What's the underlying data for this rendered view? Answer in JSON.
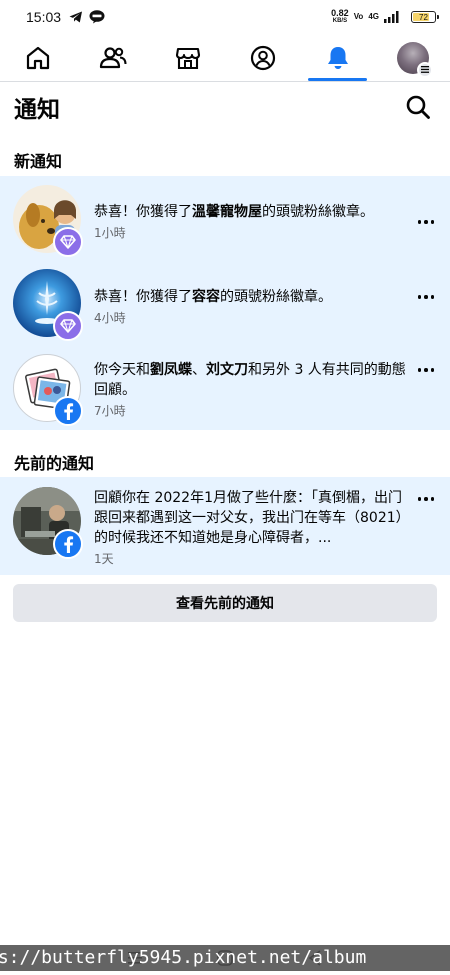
{
  "status_bar": {
    "time": "15:03",
    "net_speed_value": "0.82",
    "net_speed_unit": "KB/S",
    "volte": "Vo",
    "network": "4G",
    "battery": "72"
  },
  "nav": {
    "tabs": [
      {
        "name": "home",
        "active": false
      },
      {
        "name": "friends",
        "active": false
      },
      {
        "name": "marketplace",
        "active": false
      },
      {
        "name": "profile",
        "active": false
      },
      {
        "name": "notifications",
        "active": true
      },
      {
        "name": "menu",
        "active": false
      }
    ],
    "accent_color": "#1877f2"
  },
  "header": {
    "title": "通知"
  },
  "sections": {
    "new_title": "新通知",
    "earlier_title": "先前的通知"
  },
  "notifications": [
    {
      "parts": [
        "恭喜！你獲得了",
        "溫馨寵物屋",
        "的頭號粉絲徽章。"
      ],
      "time": "1小時",
      "badge": "diamond-icon"
    },
    {
      "parts": [
        "恭喜！你獲得了",
        "容容",
        "的頭號粉絲徽章。"
      ],
      "time": "4小時",
      "badge": "diamond-icon"
    },
    {
      "parts": [
        "你今天和",
        "劉凤蝶",
        "、",
        "刘文刀",
        "和另外 3 人有共同的動態回顧。"
      ],
      "time": "7小時",
      "badge": "facebook-icon"
    },
    {
      "parts": [
        "回顧你在 2022年1月做了些什麼：「真倒楣，出门跟回来都遇到这一对父女，我出门在等车（8021）的时候我还不知道她是身心障碍者，..."
      ],
      "time": "1天",
      "badge": "facebook-icon"
    }
  ],
  "see_previous_label": "查看先前的通知",
  "watermark": "ps://butterfly5945.pixnet.net/album"
}
